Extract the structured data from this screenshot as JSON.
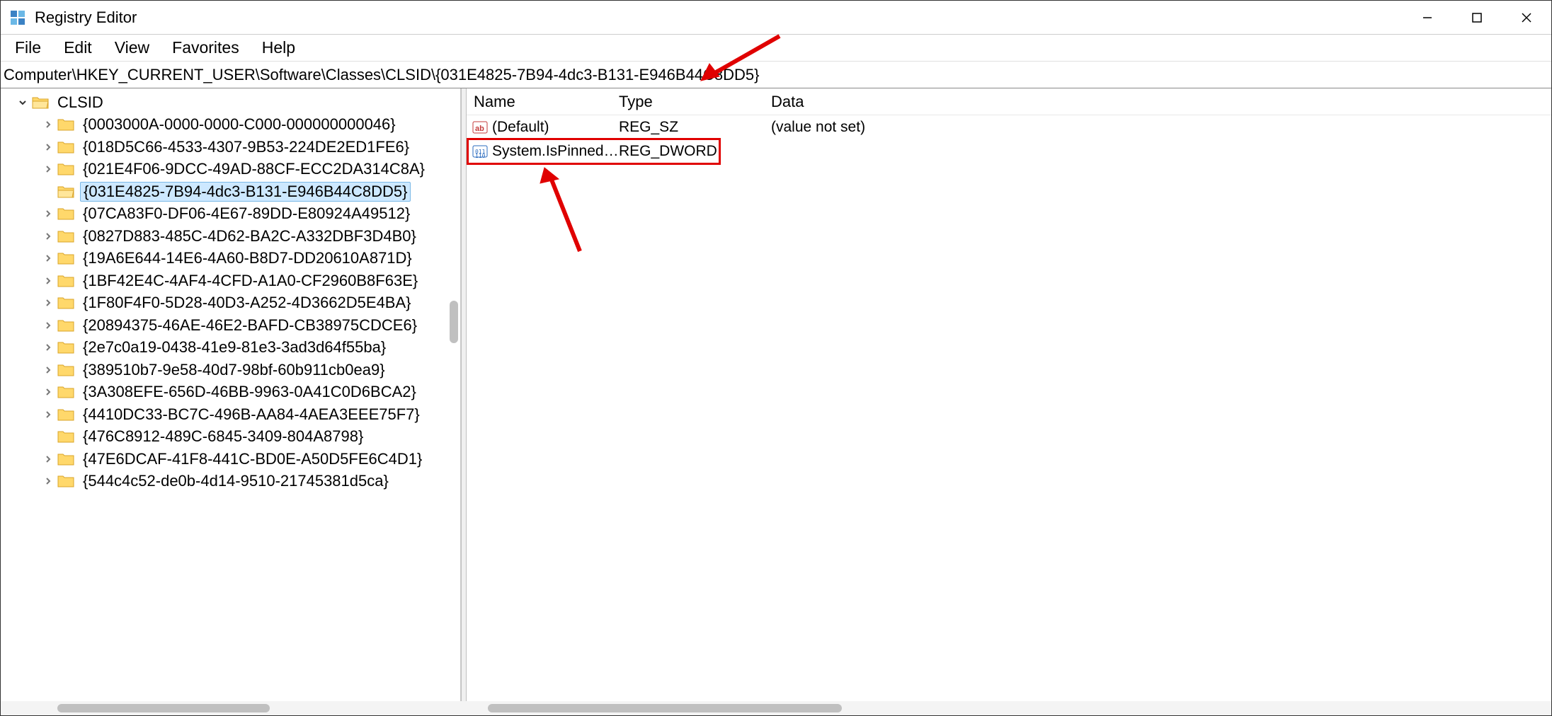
{
  "window": {
    "title": "Registry Editor"
  },
  "menu": {
    "file": "File",
    "edit": "Edit",
    "view": "View",
    "favorites": "Favorites",
    "help": "Help"
  },
  "address": "Computer\\HKEY_CURRENT_USER\\Software\\Classes\\CLSID\\{031E4825-7B94-4dc3-B131-E946B44C8DD5}",
  "tree": {
    "root_label": "CLSID",
    "items": [
      {
        "label": "{0003000A-0000-0000-C000-000000000046}"
      },
      {
        "label": "{018D5C66-4533-4307-9B53-224DE2ED1FE6}"
      },
      {
        "label": "{021E4F06-9DCC-49AD-88CF-ECC2DA314C8A}"
      },
      {
        "label": "{031E4825-7B94-4dc3-B131-E946B44C8DD5}",
        "selected": true,
        "noexp": true
      },
      {
        "label": "{07CA83F0-DF06-4E67-89DD-E80924A49512}"
      },
      {
        "label": "{0827D883-485C-4D62-BA2C-A332DBF3D4B0}"
      },
      {
        "label": "{19A6E644-14E6-4A60-B8D7-DD20610A871D}"
      },
      {
        "label": "{1BF42E4C-4AF4-4CFD-A1A0-CF2960B8F63E}"
      },
      {
        "label": "{1F80F4F0-5D28-40D3-A252-4D3662D5E4BA}"
      },
      {
        "label": "{20894375-46AE-46E2-BAFD-CB38975CDCE6}"
      },
      {
        "label": "{2e7c0a19-0438-41e9-81e3-3ad3d64f55ba}"
      },
      {
        "label": "{389510b7-9e58-40d7-98bf-60b911cb0ea9}"
      },
      {
        "label": "{3A308EFE-656D-46BB-9963-0A41C0D6BCA2}"
      },
      {
        "label": "{4410DC33-BC7C-496B-AA84-4AEA3EEE75F7}"
      },
      {
        "label": "{476C8912-489C-6845-3409-804A8798}",
        "noexp": true
      },
      {
        "label": "{47E6DCAF-41F8-441C-BD0E-A50D5FE6C4D1}"
      },
      {
        "label": "{544c4c52-de0b-4d14-9510-21745381d5ca}"
      }
    ]
  },
  "columns": {
    "name": "Name",
    "type": "Type",
    "data": "Data"
  },
  "values": [
    {
      "name": "(Default)",
      "type": "REG_SZ",
      "data": "(value not set)",
      "kind": "string"
    },
    {
      "name": "System.IsPinnedT…",
      "type": "REG_DWORD",
      "data": "",
      "kind": "dword",
      "highlighted": true
    }
  ]
}
